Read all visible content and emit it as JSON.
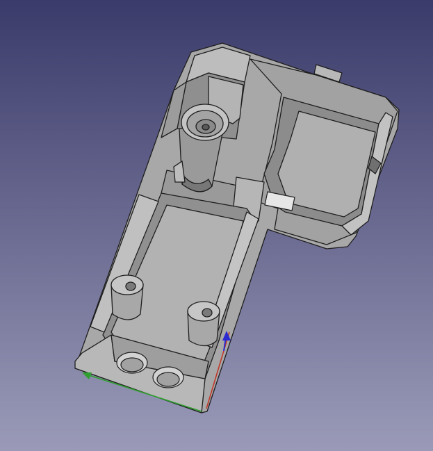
{
  "viewport": {
    "background_top": "#3b3b6b",
    "background_bottom": "#9a9ab8"
  },
  "model": {
    "body_color": "#a8a8a8",
    "shadow_color": "#6a6a6a",
    "highlight_color": "#c8c8c8",
    "edge_color": "#1e1e1e",
    "hole_color": "#8a8a8a",
    "cutout_color": "#e6e6e6"
  },
  "axes": {
    "x_color": "#2fa02f",
    "y_color": "#c0392b",
    "z_color": "#2b2bd0"
  }
}
